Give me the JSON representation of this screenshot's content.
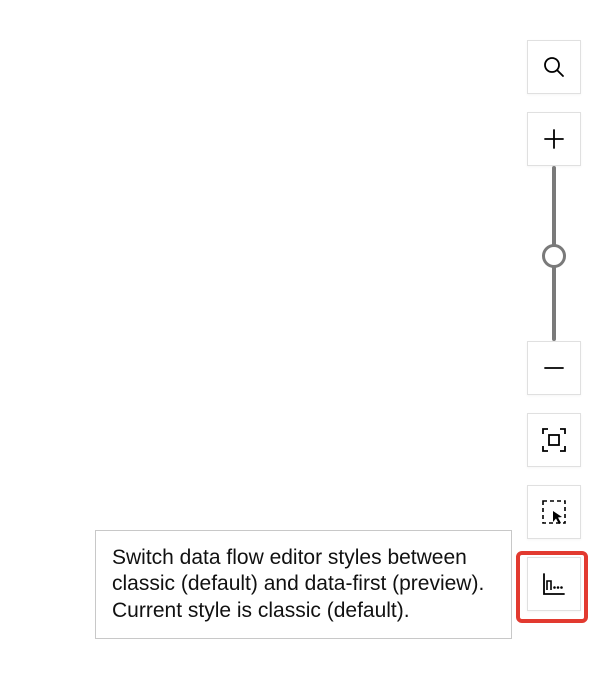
{
  "toolbar": {
    "search": {
      "name": "search-button"
    },
    "zoom_in": {
      "name": "zoom-in-button"
    },
    "zoom_out": {
      "name": "zoom-out-button"
    },
    "fit": {
      "name": "zoom-to-fit-button"
    },
    "select_area": {
      "name": "multi-select-button"
    },
    "switch_style": {
      "name": "switch-editor-style-button"
    }
  },
  "slider": {
    "min": 0,
    "max": 100,
    "value": 50
  },
  "tooltip": {
    "text": "Switch data flow editor styles between classic (default) and data-first (preview). Current style is classic (default)."
  },
  "colors": {
    "highlight": "#e23a30",
    "border": "#c8c8c8",
    "icon": "#000000",
    "track": "#7a7a7a"
  }
}
